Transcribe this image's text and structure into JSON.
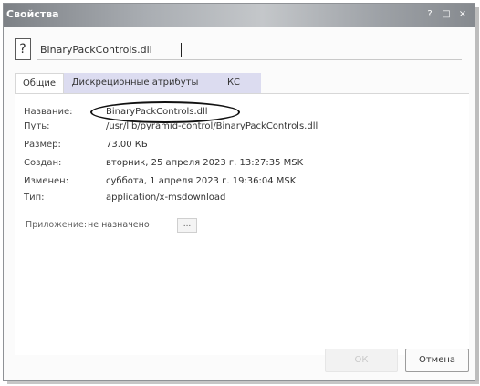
{
  "window": {
    "title": "Свойства",
    "controls": [
      "?",
      "□",
      "×"
    ]
  },
  "file": {
    "icon": "question-mark-file-icon",
    "name": "BinaryPackControls.dll"
  },
  "tabs": [
    {
      "label": "Общие",
      "active": true
    },
    {
      "label": "Дискреционные атрибуты",
      "active": false
    },
    {
      "label": "КС",
      "active": false
    }
  ],
  "properties": {
    "name": {
      "label": "Название:",
      "value": "BinaryPackControls.dll"
    },
    "path": {
      "label": "Путь:",
      "value": "/usr/lib/pyramid-control/BinaryPackControls.dll"
    },
    "size": {
      "label": "Размер:",
      "value": "73.00 КБ"
    },
    "created": {
      "label": "Создан:",
      "value": "вторник, 25 апреля 2023 г. 13:27:35 MSK"
    },
    "modified": {
      "label": "Изменен:",
      "value": "суббота, 1 апреля 2023 г. 19:36:04 MSK"
    },
    "type": {
      "label": "Тип:",
      "value": "application/x-msdownload"
    }
  },
  "application": {
    "label": "Приложение:",
    "value": "не назначено",
    "button": "..."
  },
  "buttons": {
    "ok": "ОК",
    "cancel": "Отмена"
  },
  "colors": {
    "inactive_tab": "#dcdcf0",
    "annotation_oval": "#111111"
  }
}
